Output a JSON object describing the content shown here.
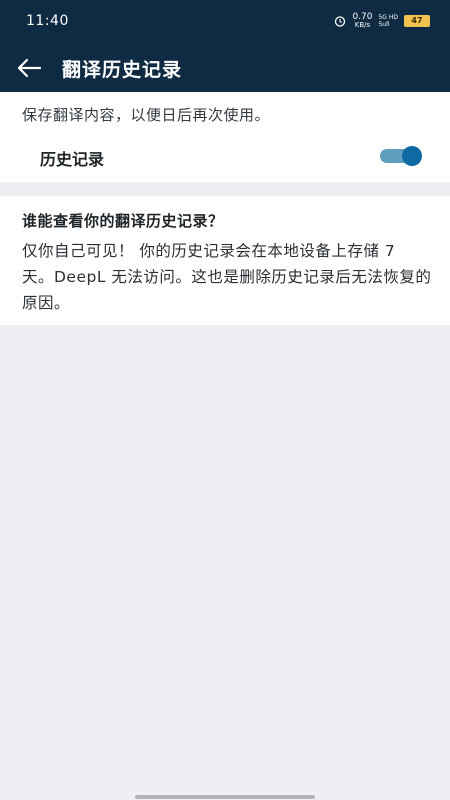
{
  "status_bar": {
    "time": "11:40",
    "net_speed_value": "0.70",
    "net_speed_unit": "KB/s",
    "signal_text": "5G HD",
    "signal_bars": "5ull",
    "battery_label": "47"
  },
  "app_bar": {
    "title": "翻译历史记录"
  },
  "settings": {
    "description": "保存翻译内容，以便日后再次使用。",
    "history_toggle_label": "历史记录",
    "history_enabled": true
  },
  "info": {
    "heading": "谁能查看你的翻译历史记录？",
    "body": "仅你自己可见！ 你的历史记录会在本地设备上存储 7 天。DeepL 无法访问。这也是删除历史记录后无法恢复的原因。"
  },
  "colors": {
    "header_bg": "#0e2b43",
    "toggle_on": "#0f6aa3",
    "page_bg": "#eeeff2"
  }
}
